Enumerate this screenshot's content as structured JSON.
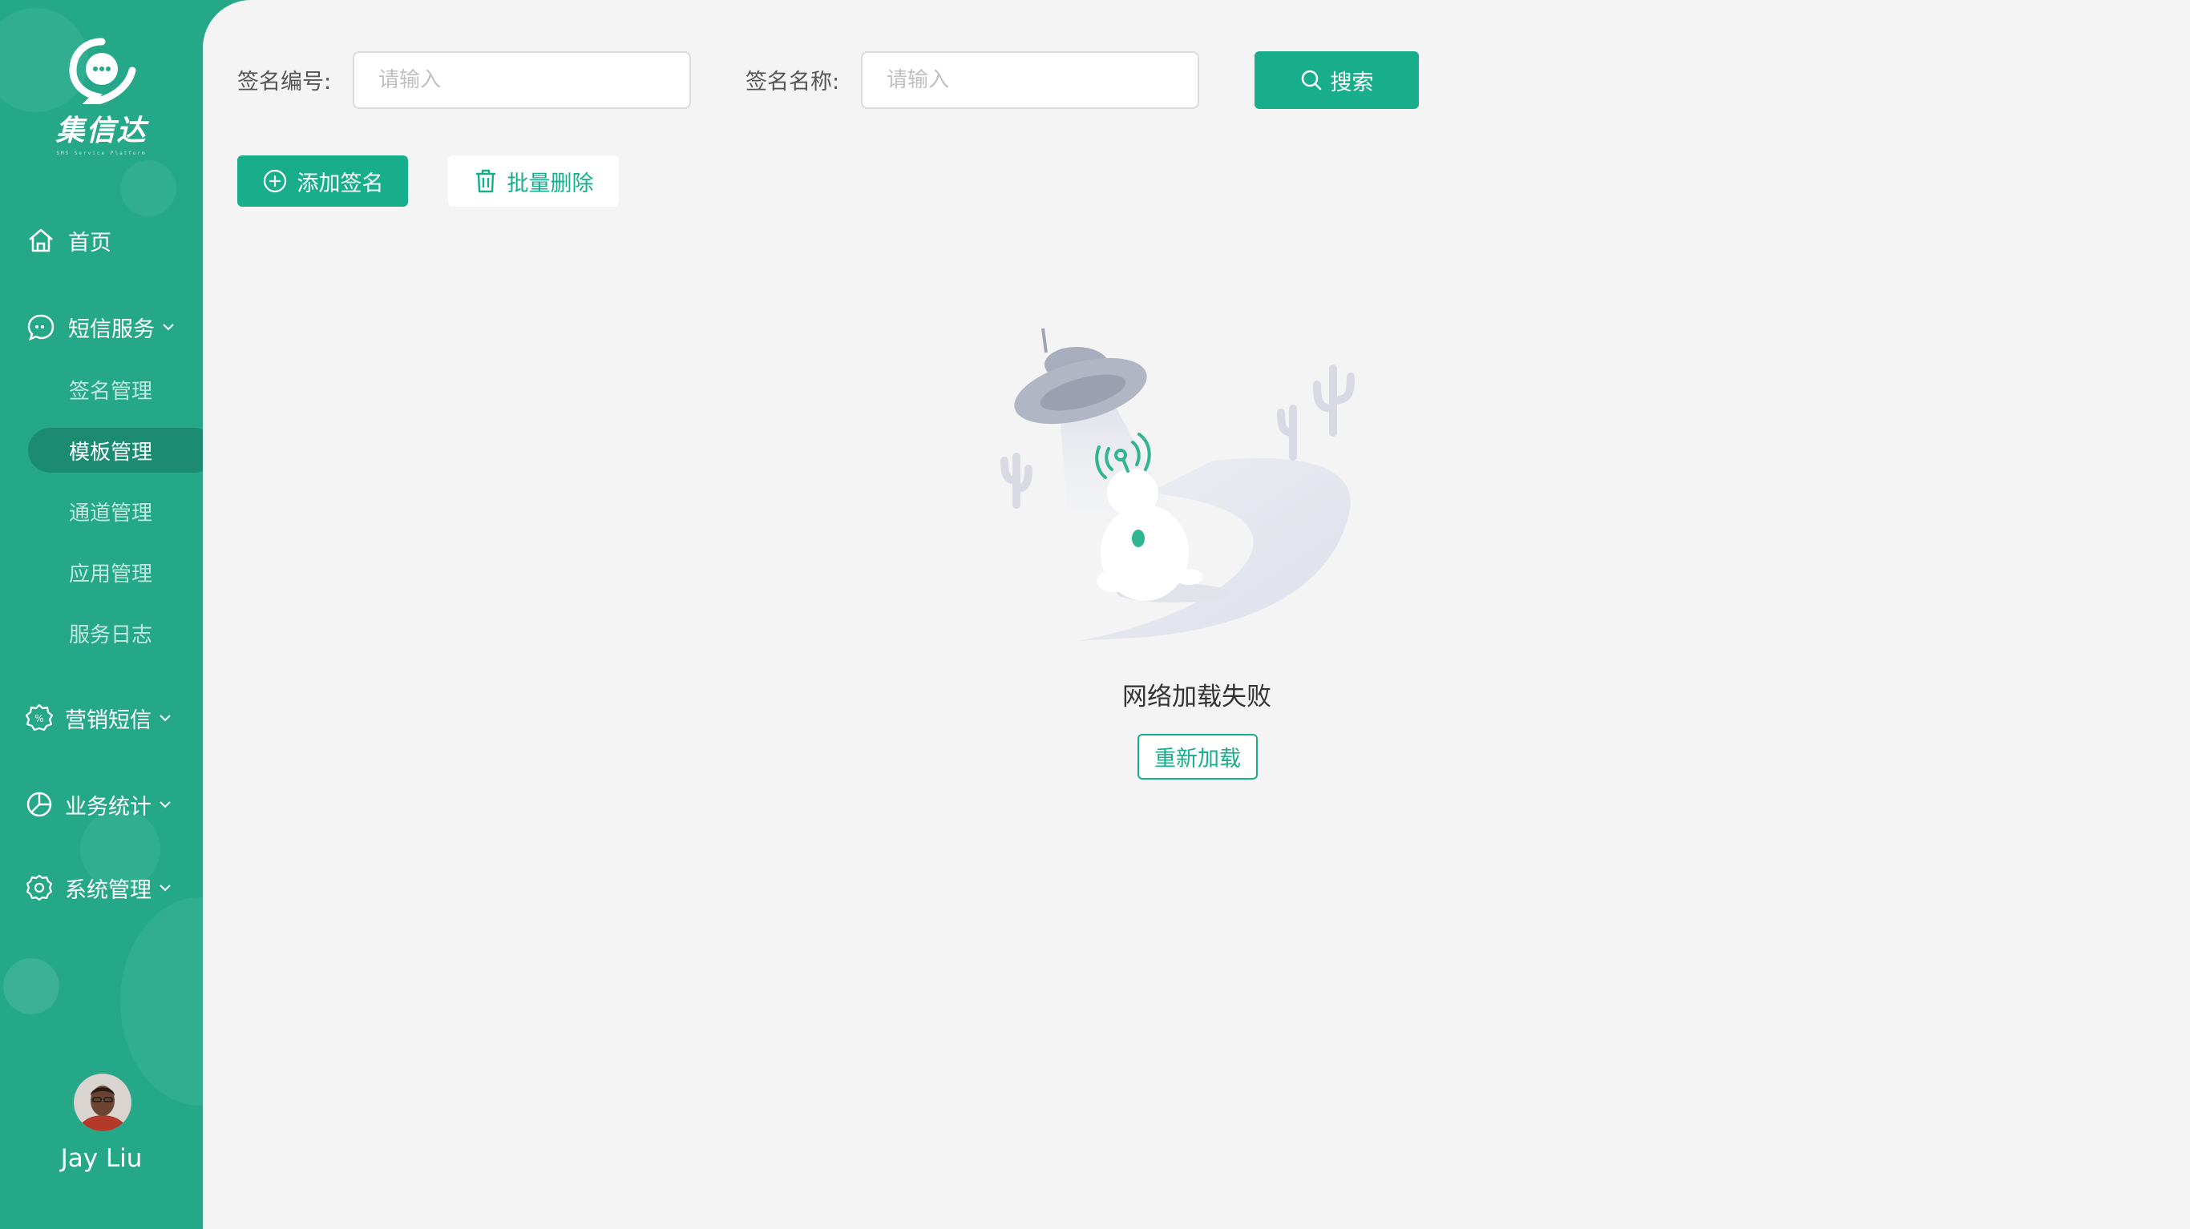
{
  "app": {
    "logo_text": "集信达",
    "logo_sub": "SMS Service Platform",
    "brand_color": "#25a888",
    "accent_color": "#18ae8b"
  },
  "sidebar": {
    "home": {
      "label": "首页",
      "icon": "home-icon"
    },
    "sms_service": {
      "label": "短信服务",
      "icon": "chat-icon",
      "children": [
        "签名管理",
        "模板管理",
        "通道管理",
        "应用管理",
        "服务日志"
      ],
      "active": "模板管理"
    },
    "marketing": {
      "label": "营销短信",
      "icon": "discount-gear-icon"
    },
    "stats": {
      "label": "业务统计",
      "icon": "pie-chart-icon"
    },
    "system": {
      "label": "系统管理",
      "icon": "gear-icon"
    },
    "user": {
      "name": "Jay Liu"
    }
  },
  "search": {
    "sign_no_label": "签名编号:",
    "sign_no_placeholder": "请输入",
    "sign_name_label": "签名名称:",
    "sign_name_placeholder": "请输入",
    "search_button": "搜索"
  },
  "toolbar": {
    "add_label": "添加签名",
    "batch_delete_label": "批量删除"
  },
  "empty_state": {
    "message": "网络加载失败",
    "reload_label": "重新加载",
    "illustration": "ufo-abducting-bear-illustration"
  }
}
